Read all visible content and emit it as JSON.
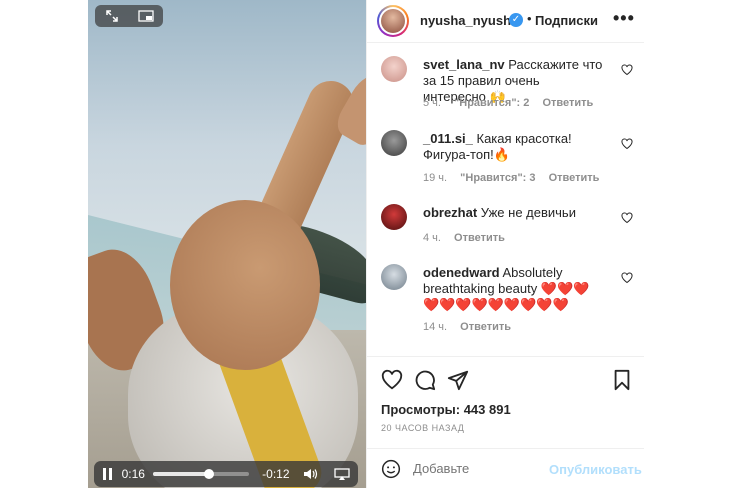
{
  "video": {
    "current_time": "0:16",
    "remaining_time": "-0:12",
    "progress_fraction": 0.58
  },
  "post": {
    "username": "nyusha_nyusha",
    "verified_mark": "✓",
    "separator": "•",
    "follow_label": "Подписки",
    "more_label": "•••",
    "views": "Просмотры: 443 891",
    "time_ago": "20 ЧАСОВ НАЗАД"
  },
  "comments": [
    {
      "username": "svet_lana_nv",
      "text": " Расскажите что за 15 правил очень интересно 🙌",
      "time": "5 ч.",
      "likes": "\"Нравится\": 2",
      "reply": "Ответить",
      "avatar_color": "#e7b7b0"
    },
    {
      "username": "_011.si_",
      "text": " Какая красотка! Фигура-топ!🔥",
      "time": "19 ч.",
      "likes": "\"Нравится\": 3",
      "reply": "Ответить",
      "avatar_color": "#5a5a5a"
    },
    {
      "username": "obrezhat",
      "text": " Уже не девичьи",
      "time": "4 ч.",
      "likes": "",
      "reply": "Ответить",
      "avatar_color": "#8b1a1a"
    },
    {
      "username": "odenedward",
      "text": " Absolutely breathtaking beauty ❤️❤️❤️❤️❤️❤️❤️❤️❤️❤️❤️❤️",
      "time": "14 ч.",
      "likes": "",
      "reply": "Ответить",
      "avatar_color": "#9aa7b3"
    }
  ],
  "add_comment": {
    "placeholder": "Добавьте",
    "post_label": "Опубликовать"
  },
  "colors": {
    "verified": "#3897f0",
    "post_button": "#b2dffc",
    "secondary_text": "#8e8e8e"
  },
  "icons": [
    "fullscreen-icon",
    "picture-in-picture-icon",
    "pause-icon",
    "volume-icon",
    "airplay-icon",
    "heart-icon",
    "comment-icon",
    "share-icon",
    "bookmark-icon",
    "emoji-icon"
  ]
}
